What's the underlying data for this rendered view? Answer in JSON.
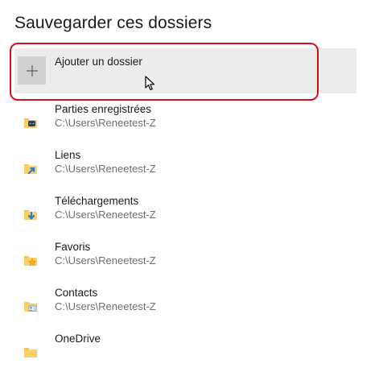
{
  "header": {
    "title": "Sauvegarder ces dossiers"
  },
  "add_folder": {
    "label": "Ajouter un dossier"
  },
  "folders": [
    {
      "name": "Parties enregistrées",
      "path": "C:\\Users\\Reneetest-Z",
      "icon": "saved-games-folder-icon"
    },
    {
      "name": "Liens",
      "path": "C:\\Users\\Reneetest-Z",
      "icon": "links-folder-icon"
    },
    {
      "name": "Téléchargements",
      "path": "C:\\Users\\Reneetest-Z",
      "icon": "downloads-folder-icon"
    },
    {
      "name": "Favoris",
      "path": "C:\\Users\\Reneetest-Z",
      "icon": "favorites-folder-icon"
    },
    {
      "name": "Contacts",
      "path": "C:\\Users\\Reneetest-Z",
      "icon": "contacts-folder-icon"
    },
    {
      "name": "OneDrive",
      "path": "",
      "icon": "onedrive-folder-icon"
    }
  ],
  "colors": {
    "highlight": "#d40e1a",
    "folder": "#f2c14e",
    "accent": "#2b7bd6"
  }
}
